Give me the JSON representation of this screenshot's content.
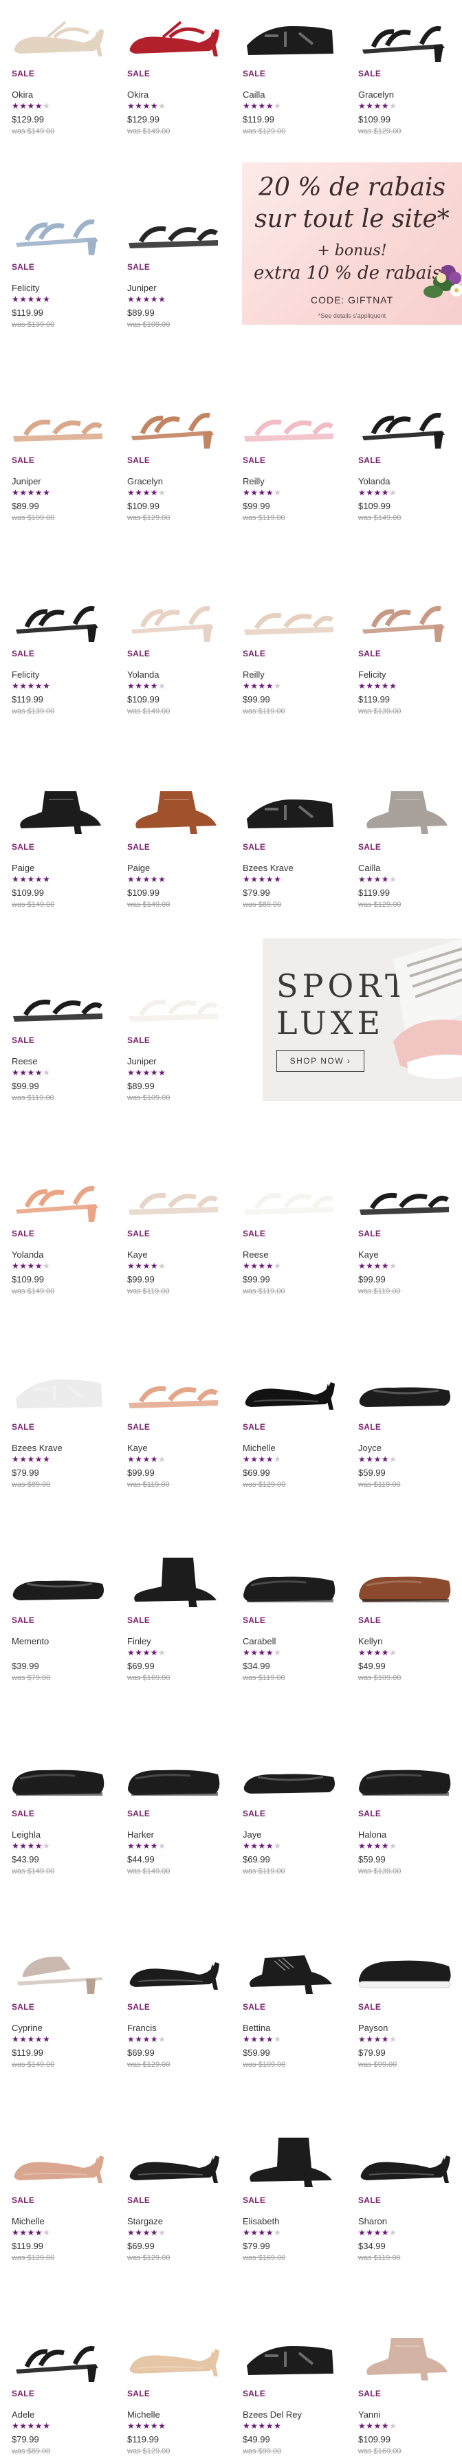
{
  "sale_label": "SALE",
  "star_glyph": "★",
  "colors": {
    "accent_purple": "#6b1a78",
    "sale_text": "#7b1e6c",
    "promo_bg": "#f9d8d6",
    "banner_bg": "#efeeec"
  },
  "promo": {
    "line1": "20 % de rabais",
    "line2": "sur tout le site*",
    "line3": "+ bonus!",
    "line4": "extra 10 % de rabais*",
    "code": "CODE: GIFTNAT",
    "fine": "*See details s'appliquent"
  },
  "sport_banner": {
    "title1": "SPORT",
    "title2": "LUXE",
    "cta": "SHOP NOW  ›"
  },
  "products": [
    {
      "name": "Okira",
      "price": "$129.99",
      "was": "was $149.00",
      "rating": 4.5,
      "shoe": "pump-strap",
      "color": "#e3d4c2"
    },
    {
      "name": "Okira",
      "price": "$129.99",
      "was": "was $149.00",
      "rating": 4.5,
      "shoe": "pump-strap",
      "color": "#b2202c"
    },
    {
      "name": "Cailla",
      "price": "$119.99",
      "was": "was $129.00",
      "rating": 4,
      "shoe": "wedge-sandal",
      "color": "#1c1c1c"
    },
    {
      "name": "Gracelyn",
      "price": "$109.99",
      "was": "was $129.00",
      "rating": 4.5,
      "shoe": "heel-sandal",
      "color": "#1c1c1c"
    },
    {
      "name": "Felicity",
      "price": "$119.99",
      "was": "was $139.00",
      "rating": 5,
      "shoe": "heel-sandal",
      "color": "#9eb3c8"
    },
    {
      "name": "Juniper",
      "price": "$89.99",
      "was": "was $109.00",
      "rating": 5,
      "shoe": "flat-sandal",
      "color": "#262626"
    },
    {
      "name": "Juniper",
      "price": "$89.99",
      "was": "was $109.00",
      "rating": 5,
      "shoe": "flat-sandal",
      "color": "#d9a88a"
    },
    {
      "name": "Gracelyn",
      "price": "$109.99",
      "was": "was $129.00",
      "rating": 4.5,
      "shoe": "heel-sandal",
      "color": "#c28461"
    },
    {
      "name": "Reilly",
      "price": "$99.99",
      "was": "was $119.00",
      "rating": 4.5,
      "shoe": "flat-sandal",
      "color": "#f1bcc4"
    },
    {
      "name": "Yolanda",
      "price": "$109.99",
      "was": "was $149.00",
      "rating": 4.5,
      "shoe": "heel-sandal",
      "color": "#1c1c1c"
    },
    {
      "name": "Felicity",
      "price": "$119.99",
      "was": "was $139.00",
      "rating": 5,
      "shoe": "heel-sandal",
      "color": "#1c1c1c"
    },
    {
      "name": "Yolanda",
      "price": "$109.99",
      "was": "was $149.00",
      "rating": 4.5,
      "shoe": "heel-sandal",
      "color": "#e8d2c5"
    },
    {
      "name": "Reilly",
      "price": "$99.99",
      "was": "was $119.00",
      "rating": 4.5,
      "shoe": "flat-sandal",
      "color": "#e6d0c0"
    },
    {
      "name": "Felicity",
      "price": "$119.99",
      "was": "was $139.00",
      "rating": 5,
      "shoe": "heel-sandal",
      "color": "#c89985"
    },
    {
      "name": "Paige",
      "price": "$109.99",
      "was": "was $149.00",
      "rating": 5,
      "shoe": "bootie",
      "color": "#1c1c1c"
    },
    {
      "name": "Paige",
      "price": "$109.99",
      "was": "was $149.00",
      "rating": 5,
      "shoe": "bootie",
      "color": "#a0522d"
    },
    {
      "name": "Bzees Krave",
      "price": "$79.99",
      "was": "was $89.00",
      "rating": 5,
      "shoe": "wedge-sandal",
      "color": "#1c1c1c"
    },
    {
      "name": "Cailla",
      "price": "$119.99",
      "was": "was $129.00",
      "rating": 4,
      "shoe": "bootie",
      "color": "#a9a19b"
    },
    {
      "name": "Reese",
      "price": "$99.99",
      "was": "was $119.00",
      "rating": 4.5,
      "shoe": "flat-sandal",
      "color": "#1c1c1c"
    },
    {
      "name": "Juniper",
      "price": "$89.99",
      "was": "was $109.00",
      "rating": 5,
      "shoe": "flat-sandal",
      "color": "#f4f1ec"
    },
    {
      "name": "Yolanda",
      "price": "$109.99",
      "was": "was $149.00",
      "rating": 4.5,
      "shoe": "heel-sandal",
      "color": "#e9a585"
    },
    {
      "name": "Kaye",
      "price": "$99.99",
      "was": "was $119.00",
      "rating": 4,
      "shoe": "flat-sandal",
      "color": "#e6d5c9"
    },
    {
      "name": "Reese",
      "price": "$99.99",
      "was": "was $119.00",
      "rating": 4.5,
      "shoe": "flat-sandal",
      "color": "#f4f4f1"
    },
    {
      "name": "Kaye",
      "price": "$99.99",
      "was": "was $119.00",
      "rating": 4,
      "shoe": "flat-sandal",
      "color": "#1c1c1c"
    },
    {
      "name": "Bzees Krave",
      "price": "$79.99",
      "was": "was $89.00",
      "rating": 5,
      "shoe": "wedge-sandal",
      "color": "#ececec"
    },
    {
      "name": "Kaye",
      "price": "$99.99",
      "was": "was $119.00",
      "rating": 4,
      "shoe": "flat-sandal",
      "color": "#e4a689"
    },
    {
      "name": "Michelle",
      "price": "$69.99",
      "was": "was $129.00",
      "rating": 4.5,
      "shoe": "pump",
      "color": "#121212"
    },
    {
      "name": "Joyce",
      "price": "$59.99",
      "was": "was $119.00",
      "rating": 4,
      "shoe": "flat",
      "color": "#1c1c1c"
    },
    {
      "name": "Memento",
      "price": "$39.99",
      "was": "was $79.00",
      "rating": 0,
      "shoe": "flat",
      "color": "#1c1c1c"
    },
    {
      "name": "Finley",
      "price": "$69.99",
      "was": "was $169.00",
      "rating": 4.5,
      "shoe": "boot",
      "color": "#1c1c1c"
    },
    {
      "name": "Carabell",
      "price": "$34.99",
      "was": "was $119.00",
      "rating": 4.5,
      "shoe": "loafer",
      "color": "#1c1c1c"
    },
    {
      "name": "Kellyn",
      "price": "$49.99",
      "was": "was $109.00",
      "rating": 4.5,
      "shoe": "loafer",
      "color": "#8b4a2e"
    },
    {
      "name": "Leighla",
      "price": "$43.99",
      "was": "was $149.00",
      "rating": 4,
      "shoe": "loafer",
      "color": "#1c1c1c"
    },
    {
      "name": "Harker",
      "price": "$44.99",
      "was": "was $149.00",
      "rating": 4.5,
      "shoe": "loafer",
      "color": "#1c1c1c"
    },
    {
      "name": "Jaye",
      "price": "$69.99",
      "was": "was $119.00",
      "rating": 4.5,
      "shoe": "flat",
      "color": "#1c1c1c"
    },
    {
      "name": "Halona",
      "price": "$59.99",
      "was": "was $139.00",
      "rating": 4.5,
      "shoe": "loafer",
      "color": "#1c1c1c"
    },
    {
      "name": "Cyprine",
      "price": "$119.99",
      "was": "was $149.00",
      "rating": 5,
      "shoe": "mule",
      "color": "#c9b9ae"
    },
    {
      "name": "Francis",
      "price": "$69.99",
      "was": "was $129.00",
      "rating": 4.5,
      "shoe": "pump",
      "color": "#1c1c1c"
    },
    {
      "name": "Bettina",
      "price": "$59.99",
      "was": "was $109.00",
      "rating": 4.5,
      "shoe": "oxford-heel",
      "color": "#1c1c1c"
    },
    {
      "name": "Payson",
      "price": "$79.99",
      "was": "was $99.00",
      "rating": 4.5,
      "shoe": "sneaker",
      "color": "#1c1c1c"
    },
    {
      "name": "Michelle",
      "price": "$119.99",
      "was": "was $129.00",
      "rating": 4.5,
      "shoe": "pump",
      "color": "#d9a68f"
    },
    {
      "name": "Stargaze",
      "price": "$69.99",
      "was": "was $129.00",
      "rating": 4.5,
      "shoe": "pump",
      "color": "#1c1c1c"
    },
    {
      "name": "Elisabeth",
      "price": "$79.99",
      "was": "was $169.00",
      "rating": 4.5,
      "shoe": "boot",
      "color": "#1c1c1c"
    },
    {
      "name": "Sharon",
      "price": "$34.99",
      "was": "was $119.00",
      "rating": 4.5,
      "shoe": "pump",
      "color": "#1c1c1c"
    },
    {
      "name": "Adele",
      "price": "$79.99",
      "was": "was $89.00",
      "rating": 5,
      "shoe": "heel-sandal",
      "color": "#1c1c1c"
    },
    {
      "name": "Michelle",
      "price": "$119.99",
      "was": "was $129.00",
      "rating": 5,
      "shoe": "pump",
      "color": "#e5c6a6"
    },
    {
      "name": "Bzees Del Rey",
      "price": "$49.99",
      "was": "was $99.00",
      "rating": 5,
      "shoe": "wedge-sandal",
      "color": "#1c1c1c"
    },
    {
      "name": "Yanni",
      "price": "$109.99",
      "was": "was $169.00",
      "rating": 4.5,
      "shoe": "bootie",
      "color": "#d3b3a3"
    }
  ]
}
